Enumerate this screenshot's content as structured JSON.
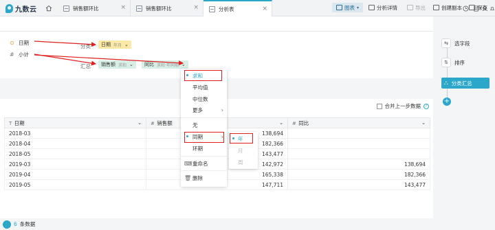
{
  "app": {
    "logo_text": "九数云"
  },
  "tabs": [
    {
      "label": "销售额环比",
      "close": "×"
    },
    {
      "label": "销售额环比",
      "close": "×"
    },
    {
      "label": "分析表",
      "close": "×"
    }
  ],
  "window_controls": [
    "clock-icon",
    "doc-icon",
    "user-icon",
    "bell-icon"
  ],
  "toolbar": {
    "chart": "图表",
    "analysis_detail": "分析详情",
    "export": "导出",
    "create_copy": "创建副本",
    "save": "保存"
  },
  "fields": [
    {
      "icon": "⊙",
      "name": "日期"
    },
    {
      "icon": "#",
      "name": "小计"
    }
  ],
  "config": {
    "group_label": "分类",
    "group_chip": {
      "name": "日期",
      "sub": "年月"
    },
    "summary_label": "汇总",
    "summary_chips": [
      {
        "name": "销售额",
        "sub": "求和"
      },
      {
        "name": "同比",
        "sub": "求和·年同期"
      }
    ]
  },
  "merge": {
    "label": "合并上一步数据",
    "help": "?"
  },
  "table": {
    "columns": [
      {
        "type_icon": "T",
        "name": "日期"
      },
      {
        "type_icon": "#",
        "name": "销售额"
      },
      {
        "type_icon": "#",
        "name": "同比"
      }
    ],
    "rows": [
      [
        "2018-03",
        "138,694",
        ""
      ],
      [
        "2018-04",
        "182,366",
        ""
      ],
      [
        "2018-05",
        "143,477",
        ""
      ],
      [
        "2019-03",
        "142,972",
        "138,694"
      ],
      [
        "2019-04",
        "165,338",
        "182,366"
      ],
      [
        "2019-05",
        "147,711",
        "143,477"
      ]
    ]
  },
  "footer": {
    "count": "6",
    "unit": "条数据"
  },
  "pipeline": {
    "steps": [
      {
        "label": "选字段"
      },
      {
        "label": "排序"
      },
      {
        "label": "分类汇总"
      }
    ],
    "add": "+"
  },
  "menu": {
    "items": [
      "求和",
      "平均值",
      "中位数",
      "更多",
      "无",
      "同期",
      "环期",
      "重命名",
      "删除"
    ]
  },
  "submenu": {
    "items": [
      "年",
      "月",
      "周"
    ]
  },
  "colors": {
    "accent": "#2aa7c9",
    "annotation": "#e02020",
    "date_chip": "#fde9a6",
    "measure_chip": "#d8efe6"
  }
}
